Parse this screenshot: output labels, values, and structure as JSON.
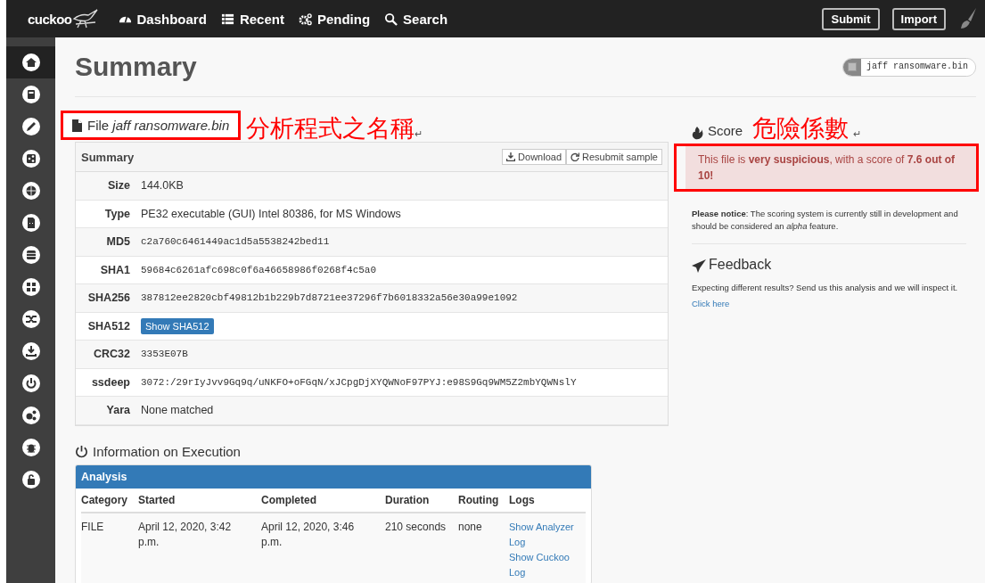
{
  "navbar": {
    "logo": "cuckoo",
    "links": [
      {
        "label": "Dashboard"
      },
      {
        "label": "Recent"
      },
      {
        "label": "Pending"
      },
      {
        "label": "Search"
      }
    ],
    "buttons": [
      "Submit",
      "Import"
    ]
  },
  "sidebar": {
    "items": [
      {
        "selected": true
      },
      {
        "selected": false
      },
      {
        "selected": false
      },
      {
        "selected": false
      },
      {
        "selected": false
      },
      {
        "selected": false
      },
      {
        "selected": false
      },
      {
        "selected": false
      },
      {
        "selected": false
      },
      {
        "selected": false
      },
      {
        "selected": false
      },
      {
        "selected": false
      },
      {
        "selected": false
      },
      {
        "selected": false
      }
    ]
  },
  "page": {
    "title": "Summary",
    "file_badge": "jaff ransomware.bin"
  },
  "file_heading": "File *jaff ransomware.bin*",
  "annotations": [
    {
      "text": "分析程式之名稱",
      "mark": "↵"
    },
    {
      "text": "危險係數",
      "mark": "↵"
    }
  ],
  "summary": {
    "title": "Summary",
    "actions": [
      "Download",
      "Resubmit sample"
    ],
    "rows": [
      {
        "label": "Size",
        "value": "144.0KB",
        "kind": "text"
      },
      {
        "label": "Type",
        "value": "PE32 executable (GUI) Intel 80386, for MS Windows",
        "kind": "text"
      },
      {
        "label": "MD5",
        "value": "c2a760c6461449ac1d5a5538242bed11",
        "kind": "mono"
      },
      {
        "label": "SHA1",
        "value": "59684c6261afc698c0f6a46658986f0268f4c5a0",
        "kind": "mono"
      },
      {
        "label": "SHA256",
        "value": "387812ee2820cbf49812b1b229b7d8721ee37296f7b6018332a56e30a99e1092",
        "kind": "mono"
      },
      {
        "label": "SHA512",
        "value": "Show SHA512",
        "kind": "button"
      },
      {
        "label": "CRC32",
        "value": "3353E07B",
        "kind": "mono"
      },
      {
        "label": "ssdeep",
        "value": "3072:/29rIyJvv9Gq9q/uNKFO+oFGqN/xJCpgDjXYQWNoF97PYJ:e98S9Gq9WM5Z2mbYQWNslY",
        "kind": "mono"
      },
      {
        "label": "Yara",
        "value": "None matched",
        "kind": "text"
      }
    ]
  },
  "execution": {
    "title": "Information on Execution",
    "panel_title": "Analysis",
    "columns": [
      "Category",
      "Started",
      "Completed",
      "Duration",
      "Routing",
      "Logs"
    ],
    "row": {
      "category": "FILE",
      "started": "April 12, 2020, 3:42 p.m.",
      "completed": "April 12, 2020, 3:46 p.m.",
      "duration": "210 seconds",
      "routing": "none",
      "logs": [
        "Show Analyzer Log",
        "Show Cuckoo Log"
      ]
    }
  },
  "score": {
    "title": "Score",
    "alert": "This file is **very suspicious**, with a score of **7.6 out of 10!**",
    "notice": "**Please notice**: The scoring system is currently still in development and should be considered an *alpha* feature."
  },
  "feedback": {
    "title": "Feedback",
    "text": "Expecting different results? Send us this analysis and we will inspect it.",
    "link": "Click here"
  }
}
